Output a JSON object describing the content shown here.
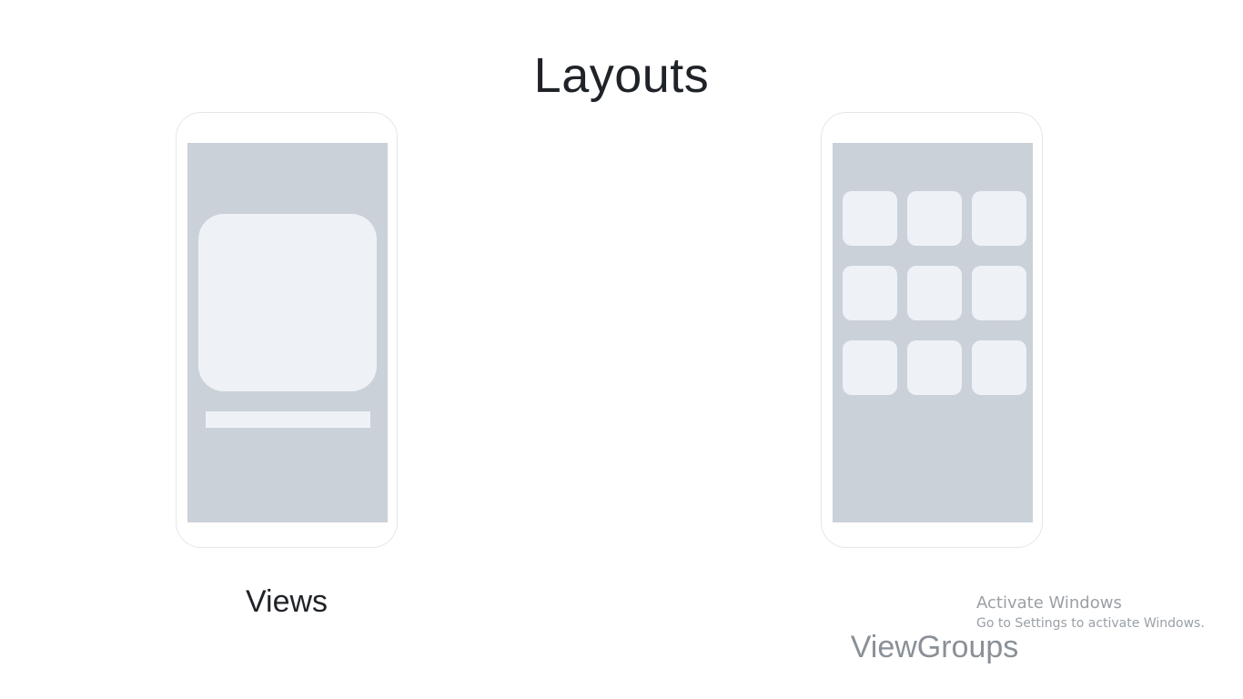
{
  "slide": {
    "title": "Layouts"
  },
  "left_panel": {
    "caption": "Views"
  },
  "right_panel": {
    "caption": "ViewGroups",
    "tiles": 9
  },
  "watermark": {
    "title": "Activate Windows",
    "subtitle": "Go to Settings to activate Windows."
  },
  "colors": {
    "background": "#ffffff",
    "screen": "#cad1d9",
    "element": "#eef2f6",
    "title_text": "#1f2328",
    "muted_text": "#8a9097"
  }
}
